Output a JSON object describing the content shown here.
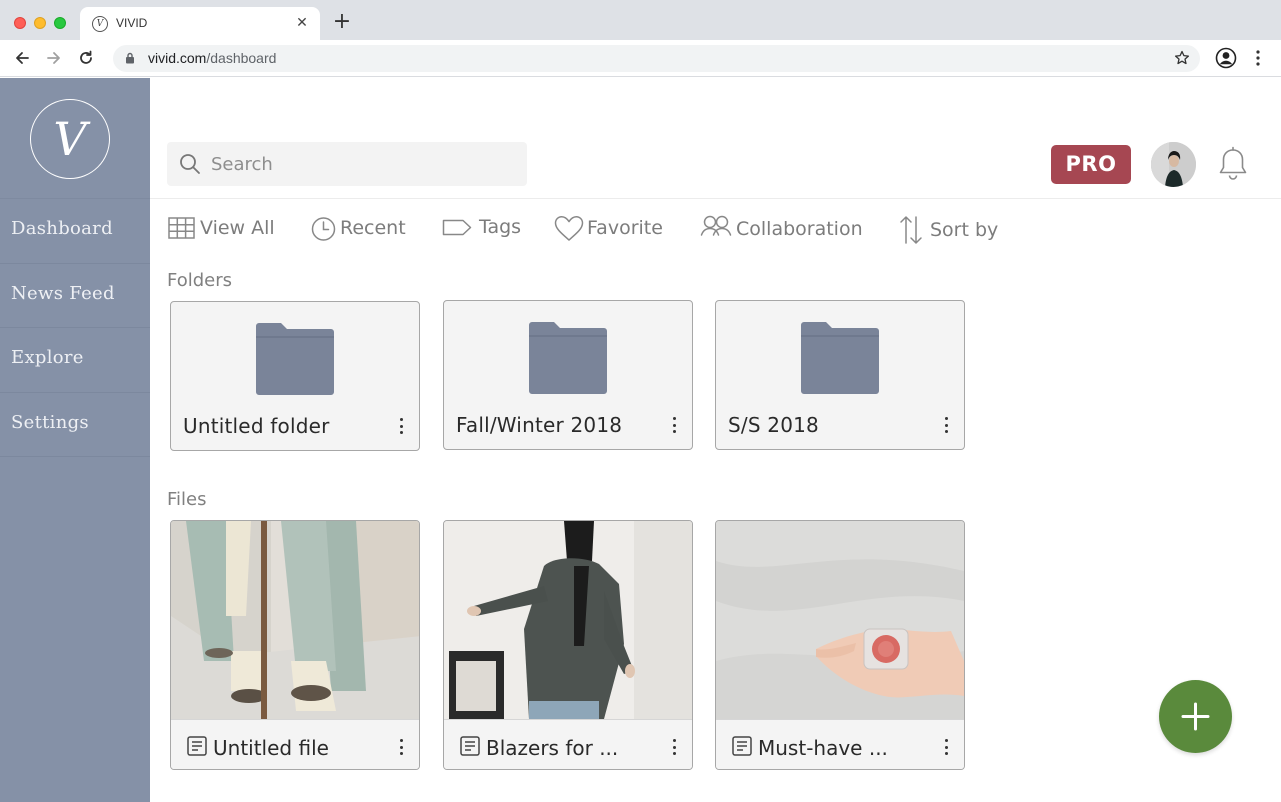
{
  "browser": {
    "tab_title": "VIVID",
    "tab_favicon": "V",
    "url_host": "vivid.com",
    "url_path": "/dashboard"
  },
  "sidebar": {
    "logo_letter": "V",
    "items": [
      {
        "label": "Dashboard"
      },
      {
        "label": "News Feed"
      },
      {
        "label": "Explore"
      },
      {
        "label": "Settings"
      }
    ]
  },
  "header": {
    "search_placeholder": "Search",
    "pro_label": "PRO"
  },
  "filters": [
    {
      "label": "View All",
      "icon": "grid-icon"
    },
    {
      "label": "Recent",
      "icon": "clock-icon"
    },
    {
      "label": "Tags",
      "icon": "tag-icon"
    },
    {
      "label": "Favorite",
      "icon": "heart-icon"
    },
    {
      "label": "Collaboration",
      "icon": "people-icon"
    },
    {
      "label": "Sort by",
      "icon": "sort-icon"
    }
  ],
  "folders": {
    "title": "Folders",
    "items": [
      {
        "label": "Untitled folder"
      },
      {
        "label": "Fall/Winter 2018"
      },
      {
        "label": "S/S 2018"
      }
    ]
  },
  "files": {
    "title": "Files",
    "items": [
      {
        "label": "Untitled file"
      },
      {
        "label": "Blazers for ..."
      },
      {
        "label": "Must-have ..."
      }
    ]
  },
  "colors": {
    "sidebar": "#8591a7",
    "pro": "#a64752",
    "fab": "#5a8a3c",
    "folder": "#7a8499"
  }
}
